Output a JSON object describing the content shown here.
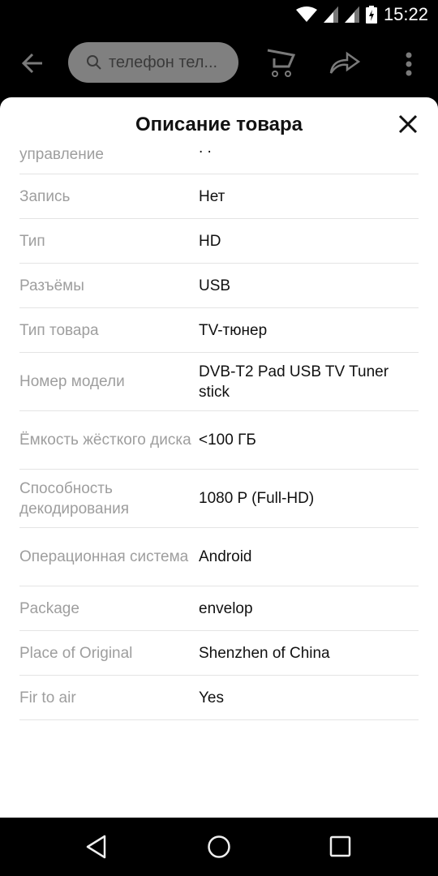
{
  "status_bar": {
    "time": "15:22",
    "icons": [
      "wifi-icon",
      "signal-icon",
      "signal-icon",
      "battery-charging-icon"
    ]
  },
  "app_bar": {
    "back_icon": "arrow-left-icon",
    "search": {
      "icon": "search-icon",
      "value": "телефон тел..."
    },
    "cart_icon": "cart-icon",
    "share_icon": "share-icon",
    "more_icon": "more-vert-icon"
  },
  "sheet": {
    "title": "Описание товара",
    "close_icon": "close-icon",
    "partial_row": {
      "key": "управление",
      "value": ". ."
    },
    "rows": [
      {
        "key": "Запись",
        "value": "Нет"
      },
      {
        "key": "Тип",
        "value": "HD"
      },
      {
        "key": "Разъёмы",
        "value": "USB"
      },
      {
        "key": "Тип товара",
        "value": "TV-тюнер"
      },
      {
        "key": "Номер модели",
        "value": "DVB-T2 Pad USB TV Tuner stick"
      },
      {
        "key": "Ёмкость жёсткого диска",
        "value": "<100 ГБ"
      },
      {
        "key": "Способность декодирования",
        "value": "1080 P (Full-HD)"
      },
      {
        "key": "Операционная система",
        "value": "Android"
      },
      {
        "key": "Package",
        "value": "envelop"
      },
      {
        "key": "Place of Original",
        "value": "Shenzhen of China"
      },
      {
        "key": "Fir to air",
        "value": "Yes"
      }
    ]
  },
  "nav_bar": {
    "back": "nav-back-icon",
    "home": "nav-home-icon",
    "recents": "nav-recents-icon"
  }
}
